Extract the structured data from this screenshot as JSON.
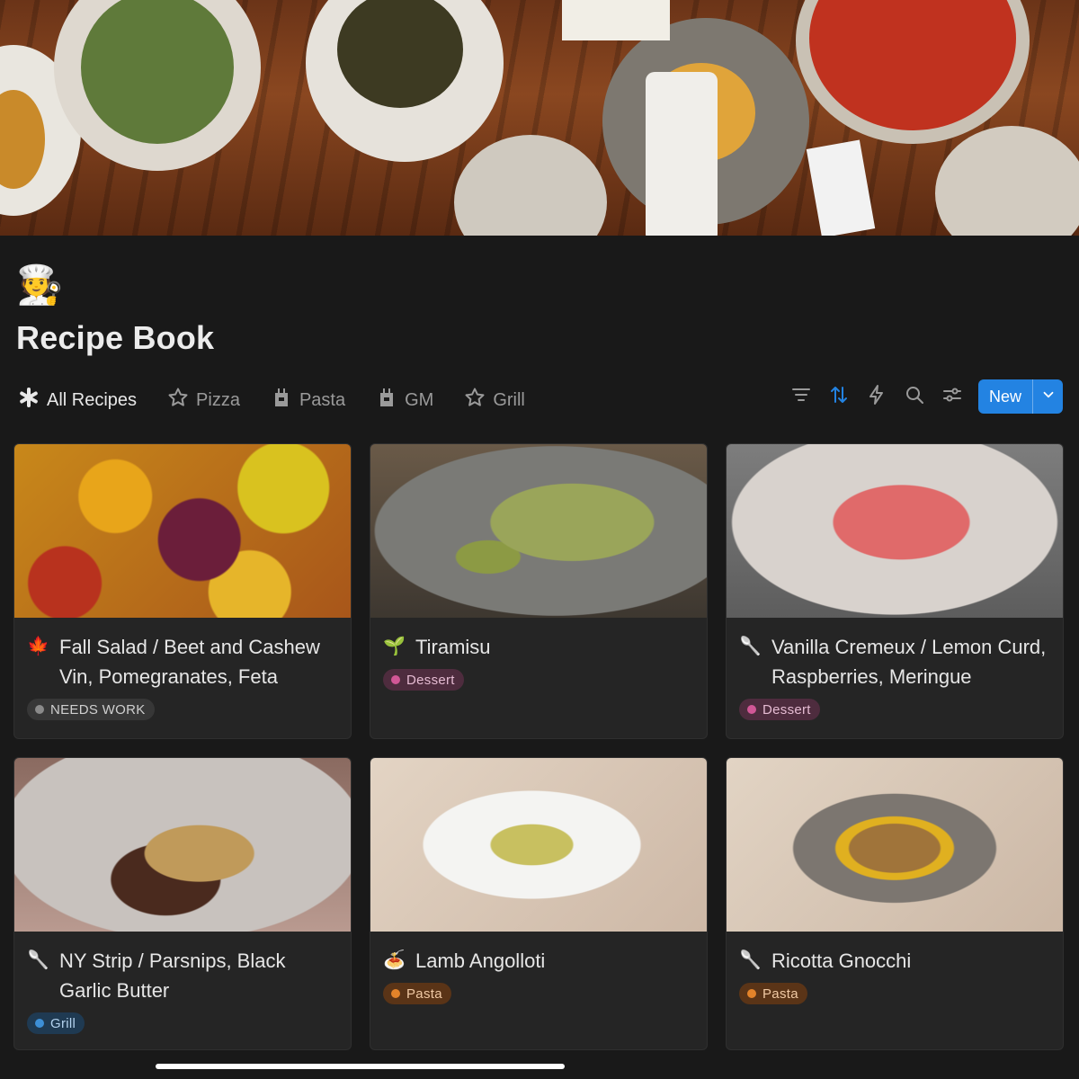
{
  "page": {
    "icon": "chef-emoji",
    "icon_glyph": "🧑‍🍳",
    "title": "Recipe Book"
  },
  "tabs": [
    {
      "label": "All Recipes",
      "icon": "asterisk-icon",
      "active": true
    },
    {
      "label": "Pizza",
      "icon": "star-icon",
      "active": false
    },
    {
      "label": "Pasta",
      "icon": "apron-icon",
      "active": false
    },
    {
      "label": "GM",
      "icon": "apron-icon",
      "active": false
    },
    {
      "label": "Grill",
      "icon": "star-icon",
      "active": false
    }
  ],
  "toolbar": {
    "icons": [
      "filter-icon",
      "sort-icon",
      "automation-bolt-icon",
      "search-icon",
      "settings-sliders-icon"
    ],
    "new_label": "New"
  },
  "cards": [
    {
      "title": "Fall Salad / Beet and Cashew Vin, Pomegranates, Feta",
      "emoji": "🍁",
      "tag": "NEEDS WORK",
      "tag_color": "gray"
    },
    {
      "title": "Tiramisu",
      "emoji": "🌱",
      "tag": "Dessert",
      "tag_color": "pink"
    },
    {
      "title": "Vanilla Cremeux / Lemon Curd, Raspberries, Meringue",
      "emoji": "🥄",
      "tag": "Dessert",
      "tag_color": "pink"
    },
    {
      "title": "NY Strip / Parsnips, Black Garlic Butter",
      "emoji": "🥄",
      "tag": "Grill",
      "tag_color": "blue"
    },
    {
      "title": "Lamb Angolloti",
      "emoji": "🍝",
      "tag": "Pasta",
      "tag_color": "orange"
    },
    {
      "title": "Ricotta Gnocchi",
      "emoji": "🥄",
      "tag": "Pasta",
      "tag_color": "orange"
    }
  ],
  "colors": {
    "background": "#191919",
    "card": "#252525",
    "accent": "#2383e2",
    "tag_gray_bg": "#373737",
    "tag_pink_bg": "#4e2c3e",
    "tag_blue_bg": "#1f3a52",
    "tag_orange_bg": "#5a3417"
  }
}
